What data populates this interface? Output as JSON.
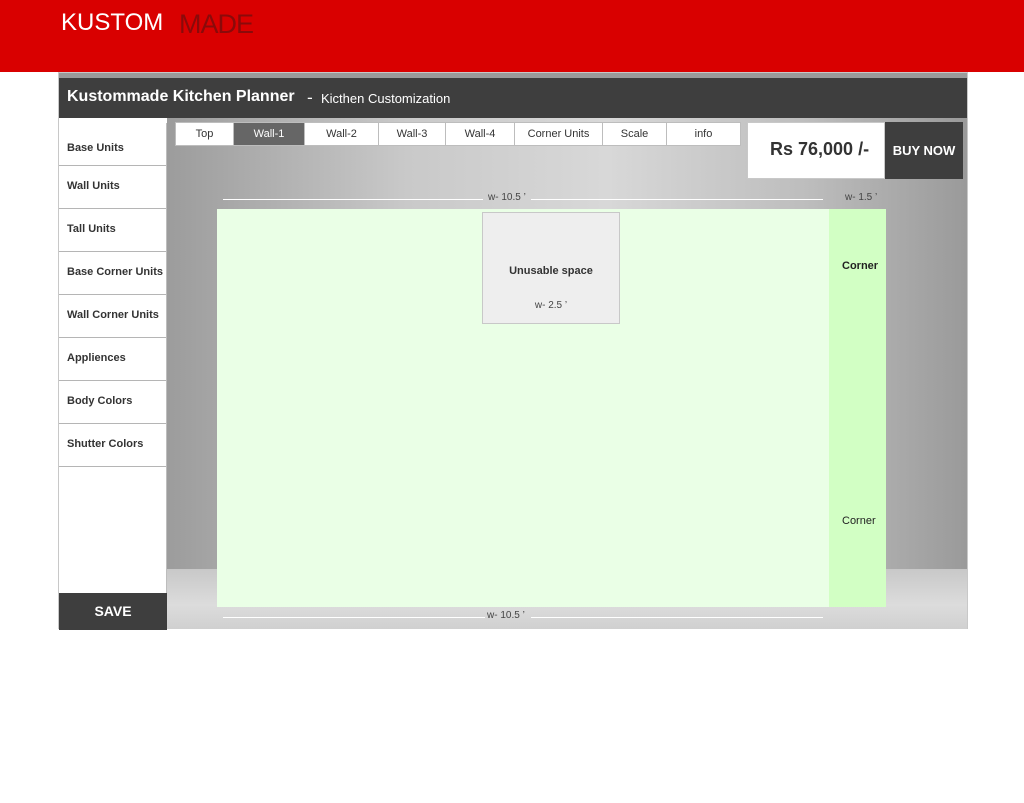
{
  "brand": {
    "logo_part1": "KUSTOM",
    "logo_part2": "MADE",
    "color": "#d90000"
  },
  "header": {
    "title": "Kustommade Kitchen Planner",
    "separator": "-",
    "subtitle": "Kicthen Customization"
  },
  "sidebar": {
    "items": [
      {
        "label": "Base Units"
      },
      {
        "label": "Wall Units"
      },
      {
        "label": "Tall Units"
      },
      {
        "label": "Base Corner Units"
      },
      {
        "label": "Wall Corner Units"
      },
      {
        "label": "Appliences"
      },
      {
        "label": "Body Colors"
      },
      {
        "label": "Shutter Colors"
      }
    ],
    "save_label": "SAVE"
  },
  "tabs": [
    {
      "label": "Top",
      "active": false
    },
    {
      "label": "Wall-1",
      "active": true
    },
    {
      "label": "Wall-2",
      "active": false
    },
    {
      "label": "Wall-3",
      "active": false
    },
    {
      "label": "Wall-4",
      "active": false
    },
    {
      "label": "Corner Units",
      "active": false
    },
    {
      "label": "Scale",
      "active": false
    },
    {
      "label": "info",
      "active": false
    }
  ],
  "price": {
    "value": "Rs 76,000 /-",
    "buy_label": "BUY NOW"
  },
  "canvas": {
    "top_width_label": "w- 10.5 ’",
    "corner_width_label": "w- 1.5 ’",
    "bottom_width_label": "w- 10.5 ’",
    "unusable": {
      "label": "Unusable space",
      "width_label": "w- 2.5 ’"
    },
    "corner_top_label": "Corner",
    "corner_bottom_label": "Corner",
    "wall_color": "#eaffe6",
    "corner_color": "#d2ffc4"
  }
}
